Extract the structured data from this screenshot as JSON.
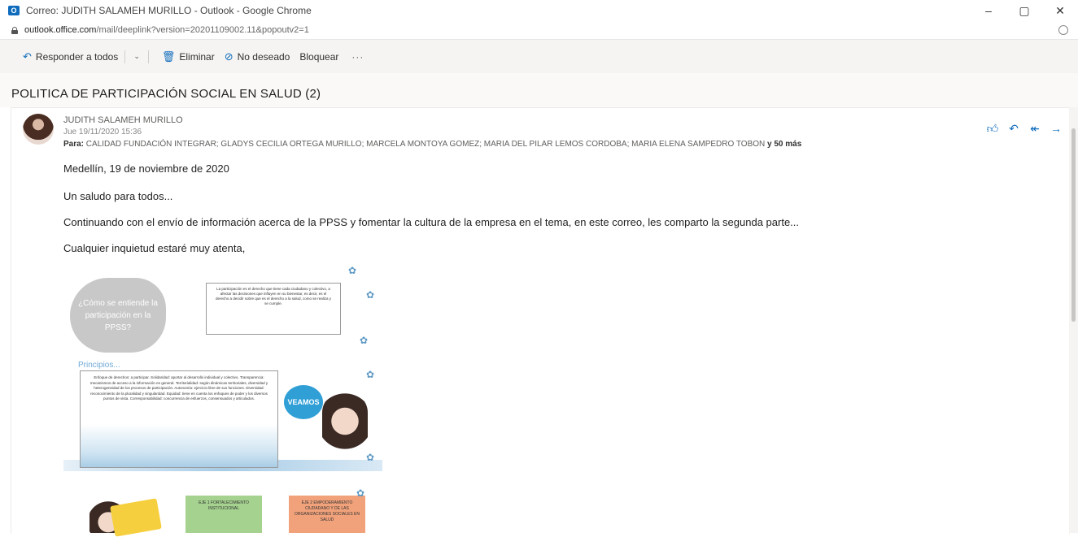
{
  "window": {
    "title": "Correo: JUDITH SALAMEH MURILLO - Outlook - Google Chrome",
    "url_domain": "outlook.office.com",
    "url_path": "/mail/deeplink?version=20201109002.11&popoutv2=1",
    "minimize": "–",
    "maximize": "▢",
    "close": "✕"
  },
  "toolbar": {
    "reply_all": "Responder a todos",
    "delete": "Eliminar",
    "junk": "No deseado",
    "block": "Bloquear",
    "more": "···"
  },
  "message": {
    "subject": "POLITICA DE PARTICIPACIÓN SOCIAL EN SALUD (2)",
    "sender": "JUDITH SALAMEH MURILLO",
    "date": "Jue 19/11/2020 15:36",
    "to_label": "Para:",
    "to_list": "CALIDAD FUNDACIÓN INTEGRAR; GLADYS CECILIA ORTEGA MURILLO; MARCELA MONTOYA GOMEZ; MARIA DEL PILAR LEMOS CORDOBA; MARIA ELENA SAMPEDRO TOBON",
    "to_more": "y 50 más",
    "body": [
      "Medellín, 19 de noviembre de 2020",
      "Un saludo para todos...",
      "Continuando con el envío de información acerca de la PPSS y fomentar la cultura de la empresa en el tema, en este correo, les comparto la segunda parte...",
      "Cualquier inquietud estaré muy atenta,"
    ]
  },
  "infographic": {
    "question": "¿Cómo se entiende la participación en la PPSS?",
    "definition": "La participación es el derecho que tiene cada ciudadano y colectivo, a afectar las decisiones que influyen en su bienestar, es decir, es el derecho a decidir sobre que es el derecho a la salud, como se realiza y se cumple.",
    "principles_title": "Principios...",
    "principles": "Enfoque de derechos: a participar. Solidaridad: aportar al desarrollo individual y colectivo. Transparencia: mecanismos de acceso a la información en general. Territorialidad: según dinámicas territoriales, diversidad y heterogeneidad de los procesos de participación. Autonomía: ejercicio libre de sus funciones. Diversidad: reconocimiento de la pluralidad y singularidad. Equidad: tiene en cuenta los enfoques de poder y los diversos puntos de vista. Corresponsabilidad: concurrencia de esfuerzos, consensuados y articulados.",
    "bubble": "VEAMOS",
    "eje1": "EJE 1 FORTALECIMIENTO INSTITUCIONAL",
    "eje2": "EJE 2 EMPODERAMIENTO CIUDADANO Y DE LAS ORGANIZACIONES SOCIALES EN SALUD"
  }
}
